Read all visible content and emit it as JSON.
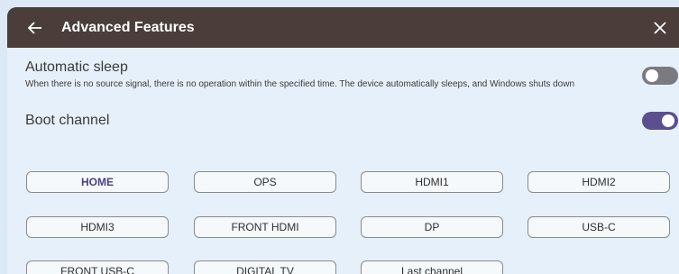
{
  "header": {
    "title": "Advanced Features"
  },
  "auto_sleep": {
    "title": "Automatic sleep",
    "description": "When there is no source signal, there is no operation within the specified time. The device automatically sleeps, and Windows shuts down",
    "enabled": false
  },
  "boot_channel": {
    "title": "Boot channel",
    "enabled": true,
    "selected": "HOME",
    "channels": [
      "HOME",
      "OPS",
      "HDMI1",
      "HDMI2",
      "HDMI3",
      "FRONT HDMI",
      "DP",
      "USB-C",
      "FRONT USB-C",
      "DIGITAL TV",
      "Last channel"
    ]
  },
  "colors": {
    "header_bg": "#4a3d3a",
    "accent": "#5b4f8f",
    "panel_bg": "#e6f0fa"
  }
}
